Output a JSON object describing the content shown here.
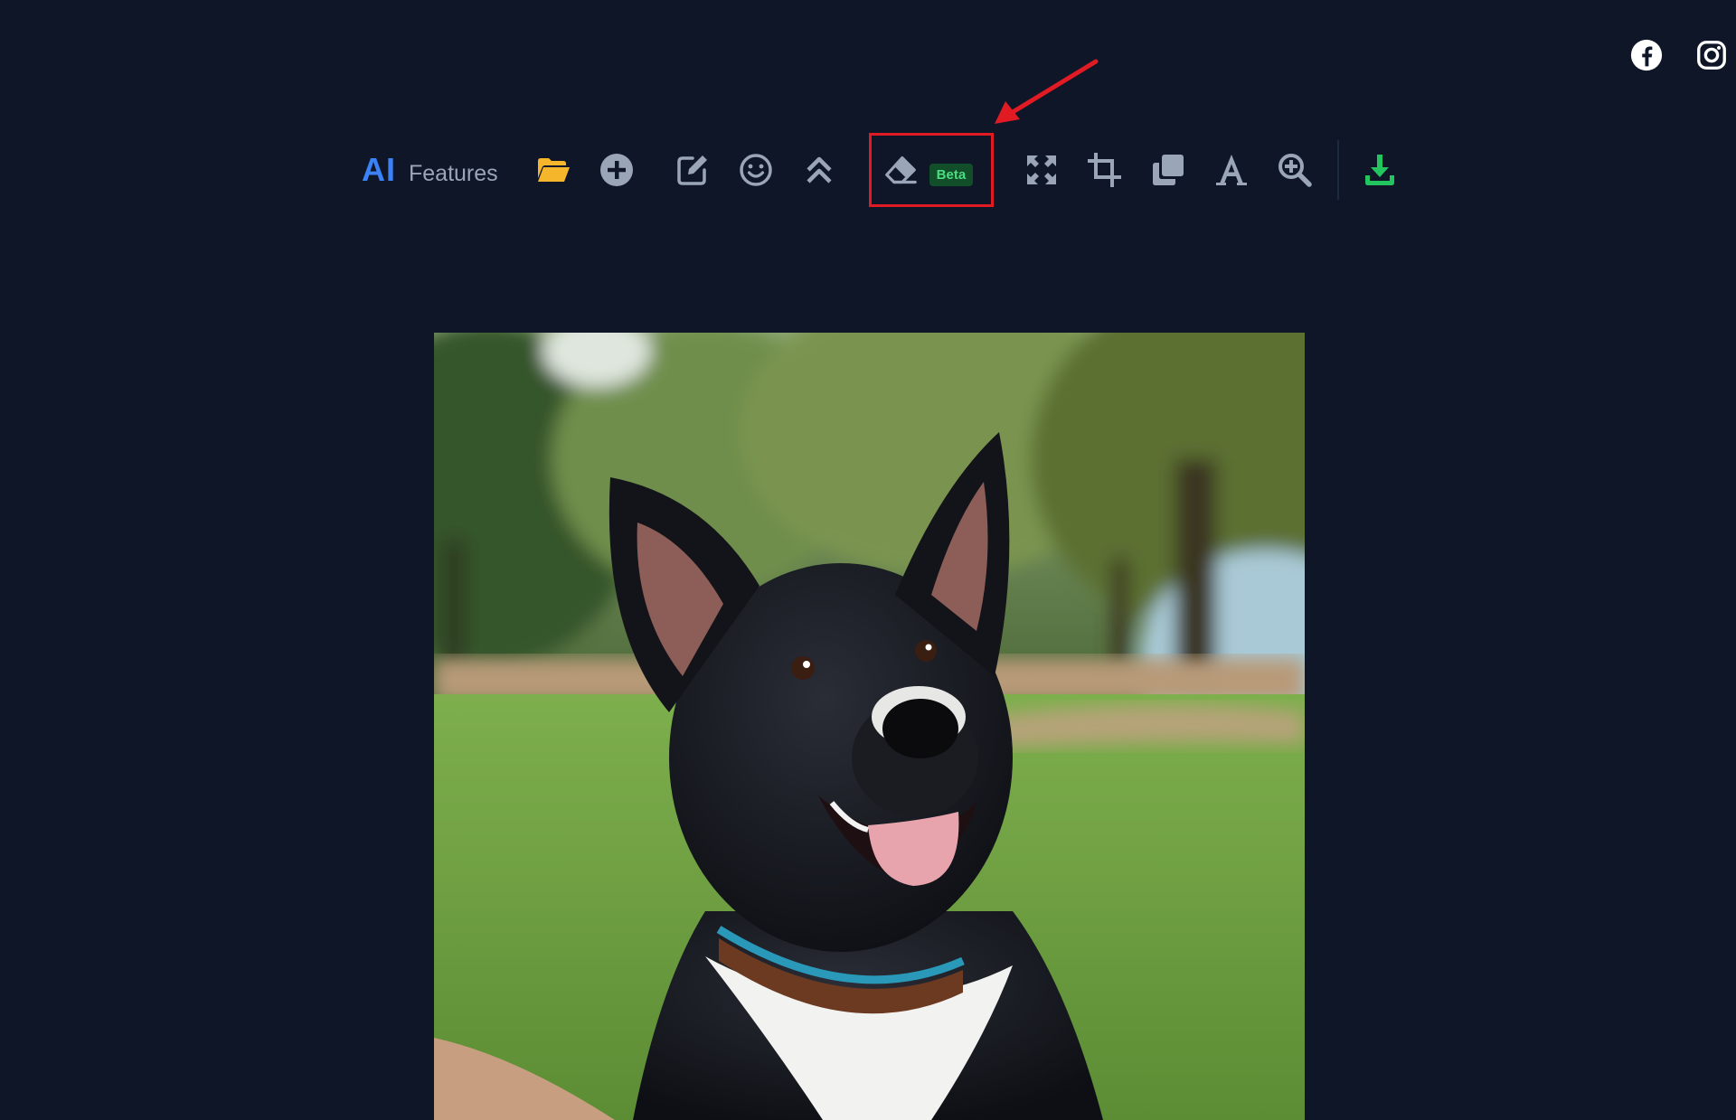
{
  "social": {
    "facebook_icon": "facebook-icon",
    "instagram_icon": "instagram-icon"
  },
  "toolbar": {
    "ai_label": "AI",
    "features_label": "Features",
    "tools": [
      {
        "name": "open-folder",
        "icon": "folder-open-icon"
      },
      {
        "name": "add",
        "icon": "plus-circle-icon"
      },
      {
        "name": "edit",
        "icon": "edit-icon"
      },
      {
        "name": "sticker",
        "icon": "smiley-icon"
      },
      {
        "name": "upscale",
        "icon": "double-chevron-up-icon"
      },
      {
        "name": "eraser",
        "icon": "eraser-icon",
        "badge": "Beta"
      },
      {
        "name": "resize",
        "icon": "expand-arrows-icon"
      },
      {
        "name": "crop",
        "icon": "crop-icon"
      },
      {
        "name": "layers",
        "icon": "copy-icon"
      },
      {
        "name": "text",
        "icon": "text-icon"
      },
      {
        "name": "zoom-in",
        "icon": "zoom-in-icon"
      },
      {
        "name": "download",
        "icon": "download-icon"
      }
    ]
  },
  "colors": {
    "background": "#0e1628",
    "ai_accent": "#3b82f6",
    "folder": "#f5b62b",
    "download": "#22c55e",
    "beta_text": "#4ade80",
    "beta_bg": "#134e2a",
    "highlight": "#e01b24",
    "icon_gray": "#9aa5b8"
  },
  "canvas": {
    "image_subject": "black and white dog in a park"
  }
}
